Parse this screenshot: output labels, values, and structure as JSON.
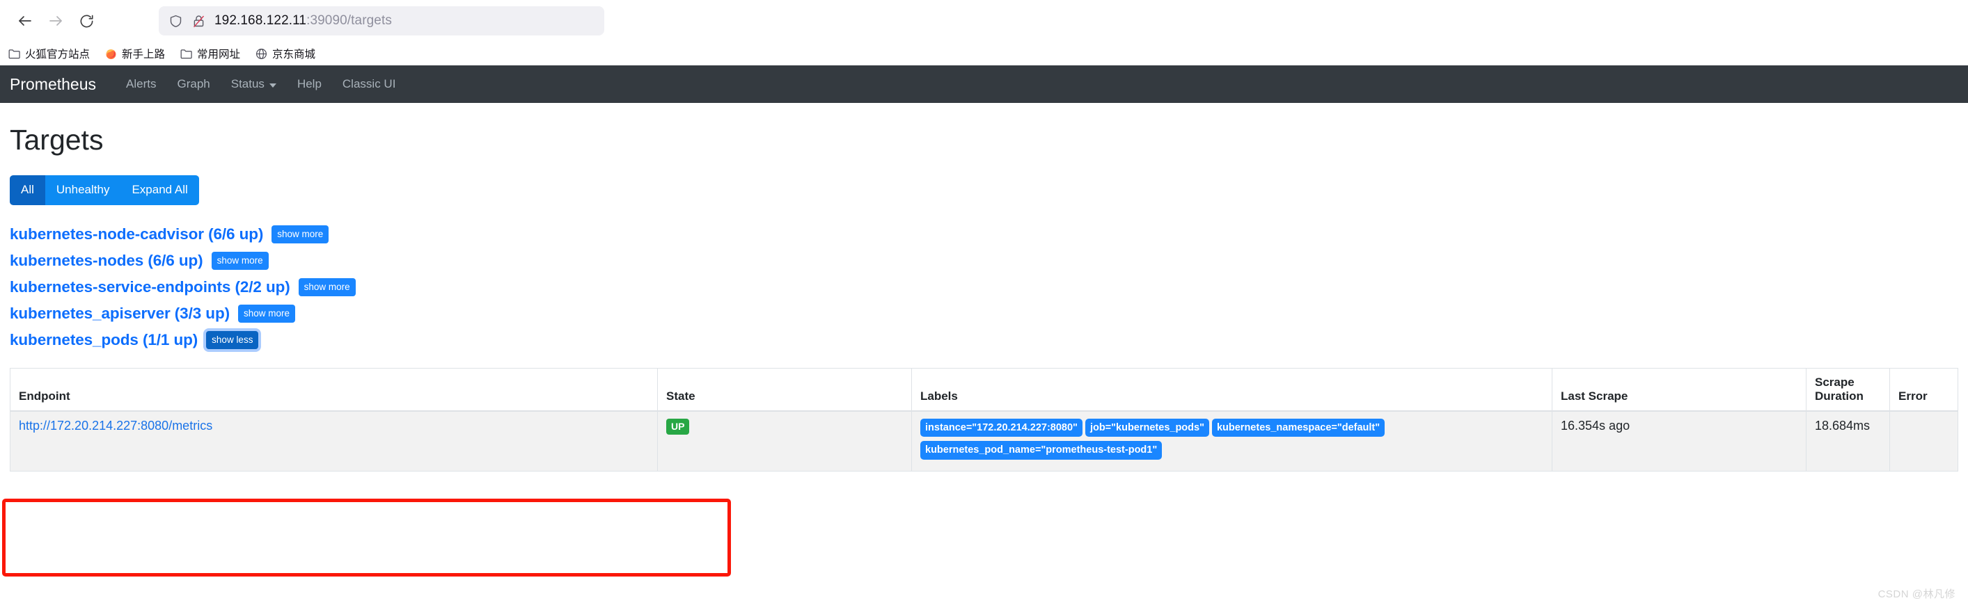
{
  "browser": {
    "nav": {
      "back": "back-arrow",
      "forward": "forward-arrow",
      "reload": "reload"
    },
    "url": {
      "host": "192.168.122.11",
      "rest": ":39090/targets",
      "shield_icon": "shield-icon",
      "lock_icon": "lock-crossed-icon"
    },
    "bookmarks": [
      {
        "label": "火狐官方站点",
        "icon": "folder-icon"
      },
      {
        "label": "新手上路",
        "icon": "firefox-icon"
      },
      {
        "label": "常用网址",
        "icon": "folder-icon"
      },
      {
        "label": "京东商城",
        "icon": "globe-icon"
      }
    ]
  },
  "navbar": {
    "brand": "Prometheus",
    "items": [
      {
        "label": "Alerts",
        "has_caret": false
      },
      {
        "label": "Graph",
        "has_caret": false
      },
      {
        "label": "Status",
        "has_caret": true
      },
      {
        "label": "Help",
        "has_caret": false
      },
      {
        "label": "Classic UI",
        "has_caret": false
      }
    ]
  },
  "page": {
    "title": "Targets",
    "filters": [
      {
        "label": "All",
        "active": true
      },
      {
        "label": "Unhealthy",
        "active": false
      },
      {
        "label": "Expand All",
        "active": false
      }
    ],
    "jobs": [
      {
        "label": "kubernetes-node-cadvisor (6/6 up)",
        "button": "show more",
        "expanded": false
      },
      {
        "label": "kubernetes-nodes (6/6 up)",
        "button": "show more",
        "expanded": false
      },
      {
        "label": "kubernetes-service-endpoints (2/2 up)",
        "button": "show more",
        "expanded": false
      },
      {
        "label": "kubernetes_apiserver (3/3 up)",
        "button": "show more",
        "expanded": false
      },
      {
        "label": "kubernetes_pods (1/1 up)",
        "button": "show less",
        "expanded": true
      }
    ],
    "table": {
      "headers": [
        "Endpoint",
        "State",
        "Labels",
        "Last Scrape",
        "Scrape Duration",
        "Error"
      ],
      "rows": [
        {
          "endpoint": "http://172.20.214.227:8080/metrics",
          "state": "UP",
          "labels": [
            "instance=\"172.20.214.227:8080\"",
            "job=\"kubernetes_pods\"",
            "kubernetes_namespace=\"default\"",
            "kubernetes_pod_name=\"prometheus-test-pod1\""
          ],
          "last_scrape": "16.354s ago",
          "scrape_duration": "18.684ms",
          "error": ""
        }
      ]
    }
  },
  "watermark": "CSDN @林凡修",
  "colors": {
    "navbar_bg": "#343a40",
    "primary_blue": "#0d6efd",
    "button_blue": "#1a86ff",
    "active_blue": "#0a64c2",
    "state_up_green": "#28a745",
    "annotation_red": "#fb1708"
  }
}
